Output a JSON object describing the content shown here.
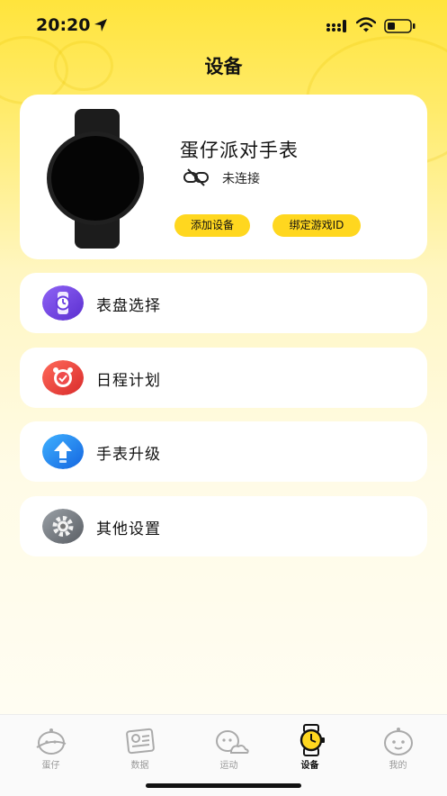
{
  "status": {
    "time": "20:20"
  },
  "header": {
    "title": "设备"
  },
  "device": {
    "name": "蛋仔派对手表",
    "connection_status": "未连接",
    "add_button": "添加设备",
    "bind_button": "绑定游戏ID"
  },
  "menu": [
    {
      "label": "表盘选择",
      "icon": "watch-face-icon",
      "color": "#7a4de8"
    },
    {
      "label": "日程计划",
      "icon": "alarm-clock-icon",
      "color": "#ec3b3b"
    },
    {
      "label": "手表升级",
      "icon": "upgrade-arrow-icon",
      "color": "#1f8ef5"
    },
    {
      "label": "其他设置",
      "icon": "gear-icon",
      "color": "#6f7379"
    }
  ],
  "tabs": [
    {
      "label": "蛋仔",
      "active": false
    },
    {
      "label": "数据",
      "active": false
    },
    {
      "label": "运动",
      "active": false
    },
    {
      "label": "设备",
      "active": true
    },
    {
      "label": "我的",
      "active": false
    }
  ],
  "colors": {
    "accent": "#ffd71f",
    "background_top": "#ffe43c"
  }
}
